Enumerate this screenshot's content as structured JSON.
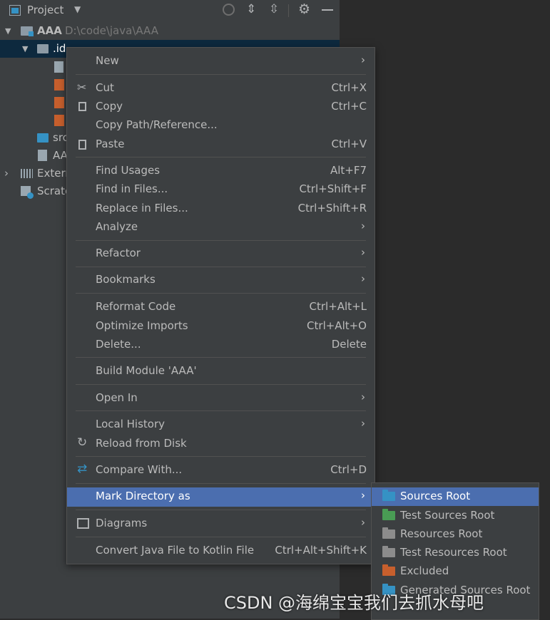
{
  "project_panel": {
    "title": "Project",
    "tree": {
      "root_name": "AAA",
      "root_path": "D:\\code\\java\\AAA",
      "idea_folder": ".id",
      "src_folder": "src",
      "file_aaa": "AA",
      "external_libraries": "Extern",
      "scratches": "Scratc"
    }
  },
  "context_menu": {
    "items": {
      "new": {
        "label": "New"
      },
      "cut": {
        "label": "Cut",
        "shortcut": "Ctrl+X"
      },
      "copy": {
        "label": "Copy",
        "shortcut": "Ctrl+C"
      },
      "copy_path": {
        "label": "Copy Path/Reference..."
      },
      "paste": {
        "label": "Paste",
        "shortcut": "Ctrl+V"
      },
      "find_usages": {
        "label": "Find Usages",
        "shortcut": "Alt+F7"
      },
      "find_in_files": {
        "label": "Find in Files...",
        "shortcut": "Ctrl+Shift+F"
      },
      "replace_in_files": {
        "label": "Replace in Files...",
        "shortcut": "Ctrl+Shift+R"
      },
      "analyze": {
        "label": "Analyze"
      },
      "refactor": {
        "label": "Refactor"
      },
      "bookmarks": {
        "label": "Bookmarks"
      },
      "reformat_code": {
        "label": "Reformat Code",
        "shortcut": "Ctrl+Alt+L"
      },
      "optimize_imports": {
        "label": "Optimize Imports",
        "shortcut": "Ctrl+Alt+O"
      },
      "delete": {
        "label": "Delete...",
        "shortcut": "Delete"
      },
      "build_module": {
        "label": "Build Module 'AAA'"
      },
      "open_in": {
        "label": "Open In"
      },
      "local_history": {
        "label": "Local History"
      },
      "reload_from_disk": {
        "label": "Reload from Disk"
      },
      "compare_with": {
        "label": "Compare With...",
        "shortcut": "Ctrl+D"
      },
      "mark_directory_as": {
        "label": "Mark Directory as"
      },
      "diagrams": {
        "label": "Diagrams"
      },
      "convert_java_kotlin": {
        "label": "Convert Java File to Kotlin File",
        "shortcut": "Ctrl+Alt+Shift+K"
      }
    }
  },
  "submenu": {
    "items": {
      "sources_root": {
        "label": "Sources Root",
        "color": "#3592c4"
      },
      "test_sources_root": {
        "label": "Test Sources Root",
        "color": "#499c54"
      },
      "resources_root": {
        "label": "Resources Root",
        "color": "#8c8c8c"
      },
      "test_resources_root": {
        "label": "Test Resources Root",
        "color": "#8c8c8c"
      },
      "excluded": {
        "label": "Excluded",
        "color": "#c75f2d"
      },
      "generated_sources_root": {
        "label": "Generated Sources Root",
        "color": "#3592c4"
      }
    }
  },
  "watermark": "CSDN @海绵宝宝我们去抓水母吧",
  "colors": {
    "panel_bg": "#3c3f41",
    "editor_bg": "#2b2b2b",
    "highlight": "#4b6eaf",
    "tree_selection": "#0d293e"
  }
}
